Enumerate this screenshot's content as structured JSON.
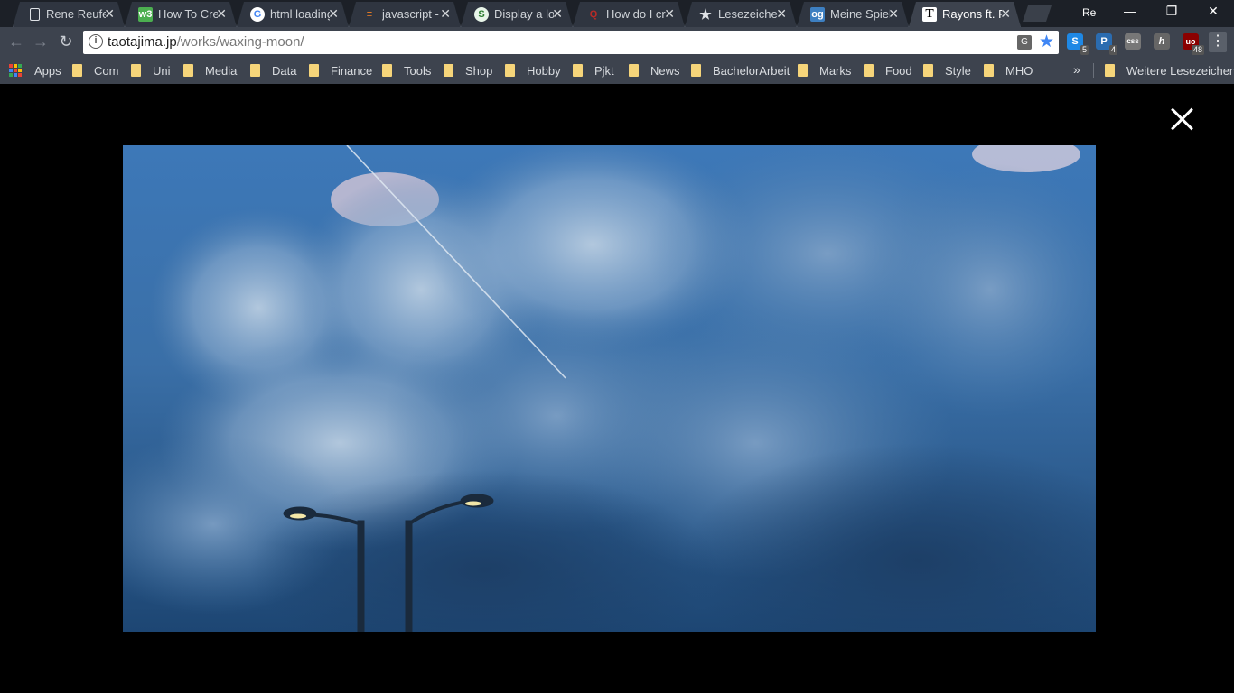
{
  "tabs": [
    {
      "label": "Rene Reufel",
      "icon": "document-icon",
      "color": "#dfe2e6"
    },
    {
      "label": "How To Crea",
      "icon": "w3-icon",
      "color": "#4caf50"
    },
    {
      "label": "html loading",
      "icon": "google-icon",
      "color": "#ffffff"
    },
    {
      "label": "javascript - I",
      "icon": "stackoverflow-icon",
      "color": "#f48024"
    },
    {
      "label": "Display a loa",
      "icon": "sitepoint-icon",
      "color": "#ffffff"
    },
    {
      "label": "How do I cre",
      "icon": "quora-icon",
      "color": "#b92b27"
    },
    {
      "label": "Lesezeichen",
      "icon": "star-icon",
      "color": "#dfe2e6"
    },
    {
      "label": "Meine Spiel",
      "icon": "og-icon",
      "color": "#3d7fc1"
    },
    {
      "label": "Rayons ft. Pe",
      "icon": "t-icon",
      "color": "#ffffff"
    }
  ],
  "profile_label": "Re",
  "url": {
    "domain": "taotajima.jp",
    "path": "/works/waxing-moon/"
  },
  "extensions": [
    {
      "name": "skype-icon",
      "color": "#1e88e5",
      "text": "S",
      "badge": "5"
    },
    {
      "name": "pushbullet-icon",
      "color": "#2b6cb0",
      "text": "P",
      "badge": "4"
    },
    {
      "name": "css-icon",
      "color": "#777777",
      "text": "css",
      "badge": ""
    },
    {
      "name": "hypothesis-icon",
      "color": "#666666",
      "text": "h",
      "badge": ""
    },
    {
      "name": "ublock-icon",
      "color": "#8b0000",
      "text": "uo",
      "badge": "48"
    }
  ],
  "bookmarks": {
    "apps_label": "Apps",
    "folders": [
      "Com",
      "Uni",
      "Media",
      "Data",
      "Finance",
      "Tools",
      "Shop",
      "Hobby",
      "Pjkt",
      "News",
      "BachelorArbeit",
      "Marks",
      "Food",
      "Style",
      "MHO"
    ],
    "overflow_label": "»",
    "other_label": "Weitere Lesezeichen"
  }
}
